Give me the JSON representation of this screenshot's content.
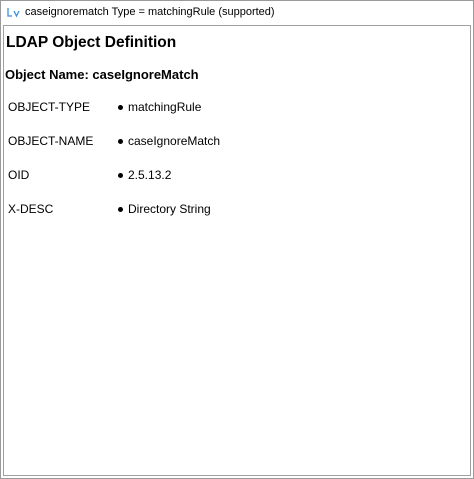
{
  "window": {
    "title": "caseignorematch Type = matchingRule (supported)",
    "icon": "ldap-viewer-icon",
    "icon_color": "#3b8ee0"
  },
  "page": {
    "heading": "LDAP Object Definition",
    "object_name": "Object Name: caseIgnoreMatch"
  },
  "attributes": [
    {
      "name": "OBJECT-TYPE",
      "value": "matchingRule"
    },
    {
      "name": "OBJECT-NAME",
      "value": "caseIgnoreMatch"
    },
    {
      "name": "OID",
      "value": "2.5.13.2"
    },
    {
      "name": "X-DESC",
      "value": "Directory String"
    }
  ]
}
